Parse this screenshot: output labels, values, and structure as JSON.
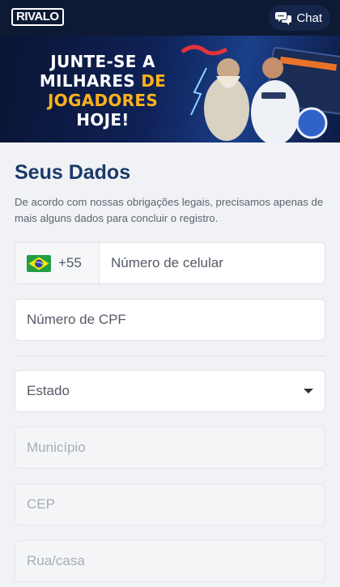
{
  "header": {
    "logo_text": "RIVALO",
    "chat_label": "Chat",
    "chat_icon": "chat-bubbles-icon"
  },
  "banner": {
    "line1": "JUNTE-SE A",
    "line2a": "MILHARES ",
    "line2b": "DE",
    "line3": "JOGADORES",
    "line4": "HOJE!",
    "highlight_color": "#ffb319"
  },
  "form": {
    "title": "Seus Dados",
    "description": "De acordo com nossas obrigações legais, precisamos apenas de mais alguns dados para concluir o registro.",
    "phone": {
      "country_flag": "brazil-flag-icon",
      "country_code": "+55",
      "placeholder": "Número de celular"
    },
    "cpf_placeholder": "Número de CPF",
    "estado_label": "Estado",
    "municipio_placeholder": "Município",
    "cep_placeholder": "CEP",
    "rua_placeholder": "Rua/casa"
  },
  "colors": {
    "header_bg": "#0e1a33",
    "title": "#1a3a6b",
    "page_bg": "#f1f2f5"
  }
}
